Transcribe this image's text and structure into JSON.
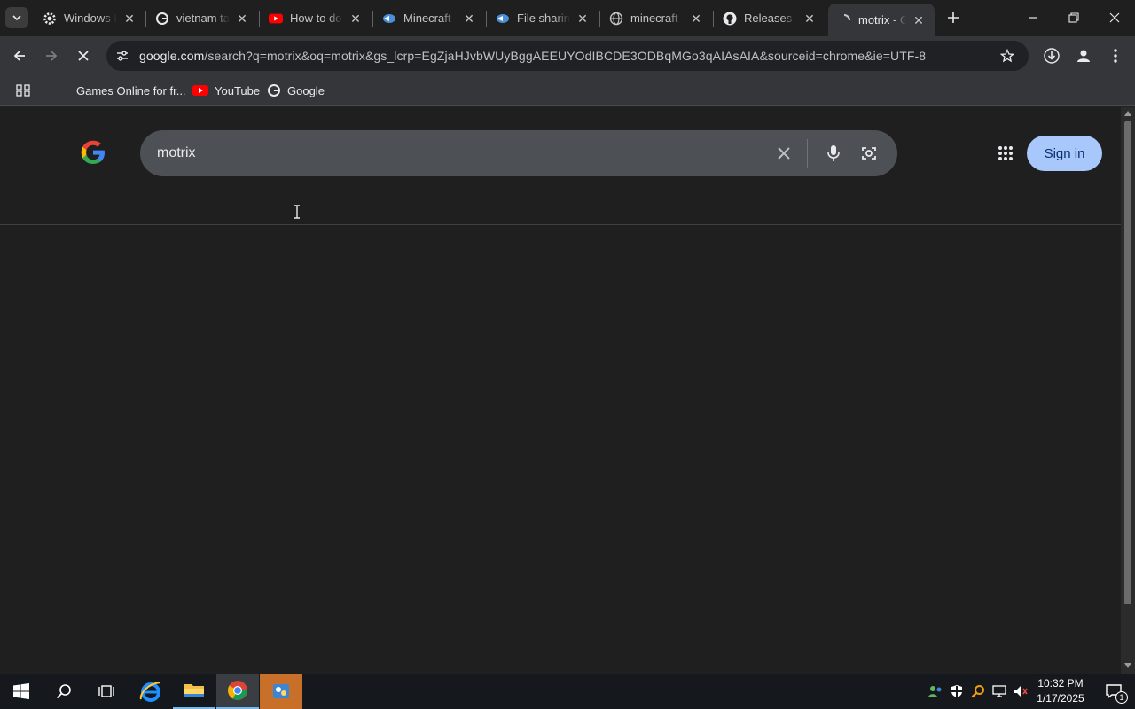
{
  "browser": {
    "tabs": [
      {
        "title": "Windows Insider",
        "icon": "gear-icon"
      },
      {
        "title": "vietnam tam",
        "icon": "google-icon"
      },
      {
        "title": "How to do",
        "icon": "youtube-icon"
      },
      {
        "title": "Minecraft",
        "icon": "fish-icon"
      },
      {
        "title": "File sharing",
        "icon": "fish-icon"
      },
      {
        "title": "minecraft",
        "icon": "globe-icon"
      },
      {
        "title": "Releases",
        "icon": "github-icon"
      },
      {
        "title": "motrix - Google",
        "icon": "loading-icon",
        "active": true
      }
    ],
    "address": {
      "domain": "google.com",
      "path": "/search?q=motrix&oq=motrix&gs_lcrp=EgZjaHJvbWUyBggAEEUYOdIBCDE3ODBqMGo3qAIAsAIA&sourceid=chrome&ie=UTF-8"
    },
    "bookmarks": [
      {
        "label": "Games Online for fr...",
        "icon": "blank-icon"
      },
      {
        "label": "YouTube",
        "icon": "youtube-icon"
      },
      {
        "label": "Google",
        "icon": "google-icon"
      }
    ]
  },
  "page": {
    "search_query": "motrix",
    "sign_in_label": "Sign in"
  },
  "taskbar": {
    "time": "10:32 PM",
    "date": "1/17/2025",
    "notification_count": "1"
  },
  "colors": {
    "accent": "#a8c7fa",
    "background": "#1f1f1f"
  }
}
